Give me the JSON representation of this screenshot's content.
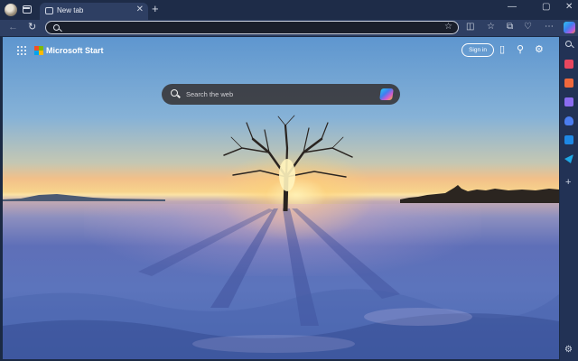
{
  "browser": {
    "tabs": [
      {
        "title": "New tab",
        "close_glyph": "✕"
      }
    ],
    "new_tab_glyph": "+",
    "window_controls": {
      "minimize": "—",
      "maximize": "▢",
      "close": "✕"
    },
    "nav": {
      "back": "←",
      "refresh": "↻"
    },
    "address": {
      "value": ""
    },
    "toolbar_icons": [
      "split-screen-icon",
      "favorites-icon",
      "collections-icon",
      "more-icon",
      "copilot-icon"
    ],
    "toolbar_glyphs": {
      "split": "◫",
      "favorites": "☆",
      "collections": "⧉",
      "more": "⋯",
      "star": "☆"
    }
  },
  "page": {
    "brand": "Microsoft Start",
    "brand_logo_colors": [
      "#f25022",
      "#7fba00",
      "#00a4ef",
      "#ffb900"
    ],
    "signin_label": "Sign in",
    "top_icons": {
      "mobile": "▯",
      "rewards": "⚲",
      "settings": "⚙"
    },
    "search": {
      "placeholder": "Search the web"
    },
    "background": "Winter sunset behind a lone tree in a snowy field"
  },
  "sidebar": {
    "items": [
      {
        "name": "search-icon"
      },
      {
        "name": "tag-icon",
        "color": "#e8475f"
      },
      {
        "name": "briefcase-icon",
        "color": "#f0683c"
      },
      {
        "name": "games-icon",
        "color": "#8b6cf0"
      },
      {
        "name": "shield-icon",
        "color": "#4b7df0"
      },
      {
        "name": "outlook-icon",
        "color": "#1e88e5"
      },
      {
        "name": "send-icon",
        "color": "#1ea7e5"
      }
    ],
    "add_glyph": "+",
    "settings_glyph": "⚙"
  }
}
